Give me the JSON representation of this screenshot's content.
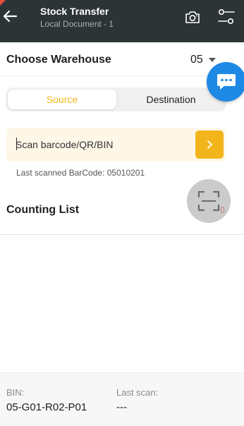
{
  "header": {
    "title": "Stock Transfer",
    "subtitle": "Local Document - 1",
    "icons": [
      "back-arrow-icon",
      "camera-icon",
      "settings-sliders-icon"
    ]
  },
  "warehouse": {
    "label": "Choose Warehouse",
    "selected": "05"
  },
  "tabs": [
    {
      "label": "Source",
      "active": true
    },
    {
      "label": "Destination",
      "active": false
    }
  ],
  "scan": {
    "placeholder": "Scan barcode/QR/BIN",
    "value": "",
    "last_scanned": "Last scanned BarCode: 05010201"
  },
  "counting_list": {
    "title": "Counting List",
    "count": "0"
  },
  "footer": {
    "bin_label": "BIN:",
    "bin_value": "05-G01-R02-P01",
    "last_scan_label": "Last scan:",
    "last_scan_value": "---"
  },
  "colors": {
    "header_bg": "#2d3436",
    "accent": "#f2b51b",
    "chat_fab": "#1e88e5",
    "badge": "#e84a3c"
  }
}
